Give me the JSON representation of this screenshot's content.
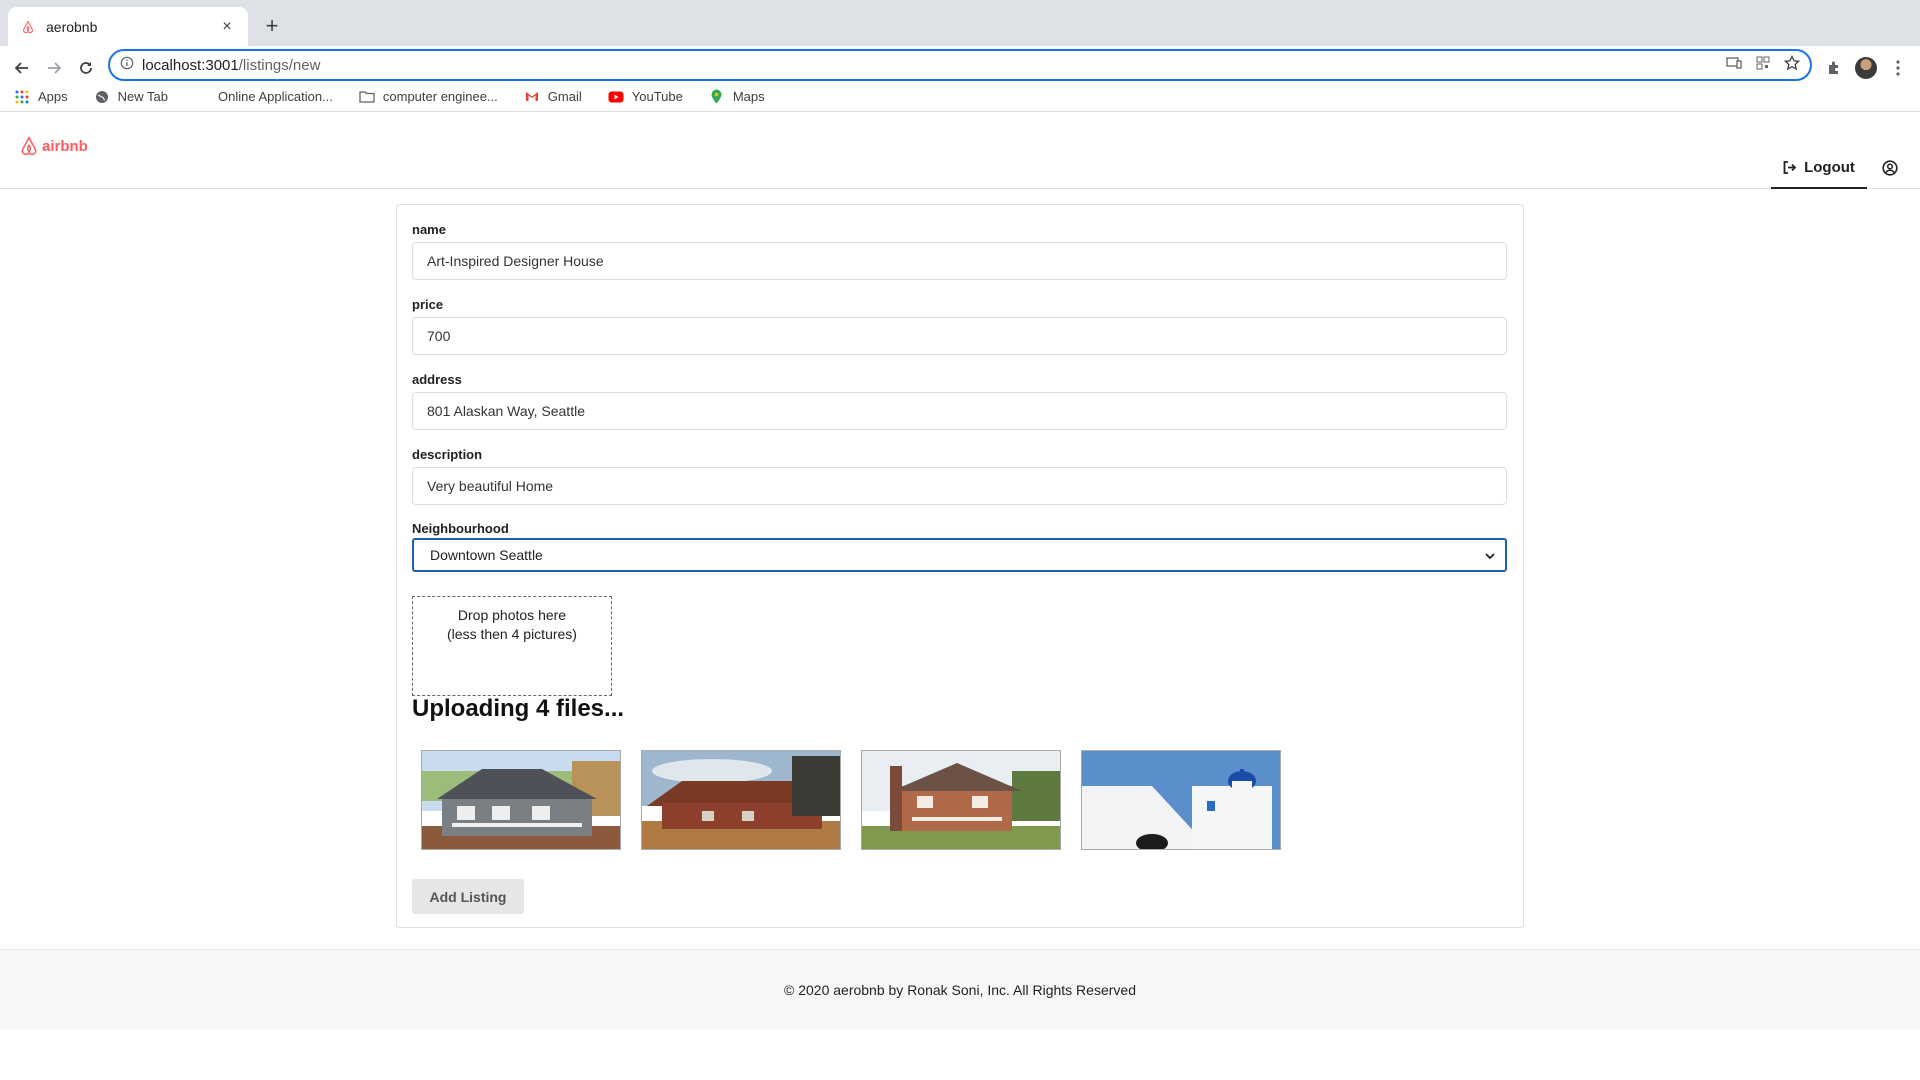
{
  "browser": {
    "tab_title": "aerobnb",
    "tab_close_glyph": "×",
    "new_tab_glyph": "+",
    "url_host": "localhost:3001",
    "url_path": "/listings/new",
    "bookmarks": [
      {
        "label": "Apps",
        "icon": "apps-grid-icon"
      },
      {
        "label": "New Tab",
        "icon": "globe-icon"
      },
      {
        "label": "Online Application...",
        "icon": "blank-page-icon"
      },
      {
        "label": "computer enginee...",
        "icon": "folder-icon"
      },
      {
        "label": "Gmail",
        "icon": "gmail-icon"
      },
      {
        "label": "YouTube",
        "icon": "youtube-icon"
      },
      {
        "label": "Maps",
        "icon": "maps-pin-icon"
      }
    ]
  },
  "header": {
    "logo_text": "airbnb",
    "logout_label": "Logout",
    "brand_color": "#ff5a5f"
  },
  "form": {
    "name_label": "name",
    "name_value": "Art-Inspired Designer House",
    "price_label": "price",
    "price_value": "700",
    "address_label": "address",
    "address_value": "801 Alaskan Way, Seattle",
    "description_label": "description",
    "description_value": "Very beautiful Home",
    "neighbourhood_label": "Neighbourhood",
    "neighbourhood_value": "Downtown Seattle",
    "dropzone_line1": "Drop photos here",
    "dropzone_line2": "(less then 4 pictures)",
    "uploading_text": "Uploading 4 files...",
    "thumbnails": [
      "house-photo-1",
      "house-photo-2",
      "house-photo-3",
      "house-photo-4"
    ],
    "submit_label": "Add Listing"
  },
  "footer": {
    "copyright": "© 2020 aerobnb by Ronak Soni, Inc. All Rights Reserved"
  }
}
